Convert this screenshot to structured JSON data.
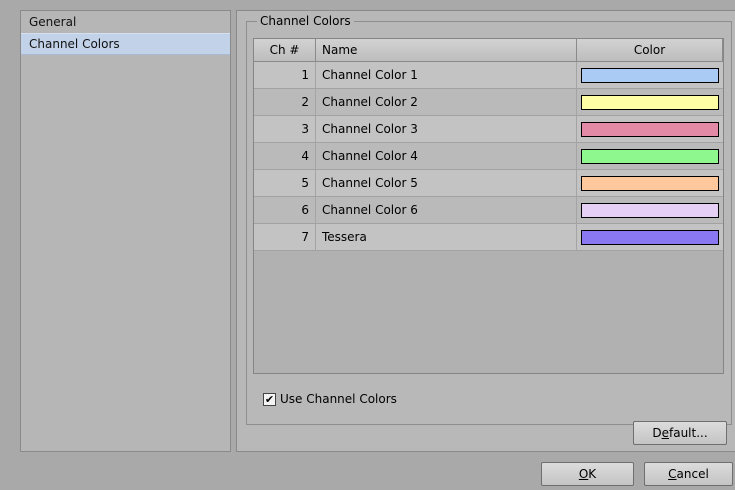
{
  "nav": {
    "items": [
      {
        "label": "General",
        "selected": false
      },
      {
        "label": "Channel Colors",
        "selected": true
      }
    ]
  },
  "group": {
    "title": "Channel Colors"
  },
  "table": {
    "columns": [
      "Ch #",
      "Name",
      "Color"
    ],
    "rows": [
      {
        "num": "1",
        "name": "Channel Color 1",
        "color": "#a9cbf4"
      },
      {
        "num": "2",
        "name": "Channel Color 2",
        "color": "#fefea4"
      },
      {
        "num": "3",
        "name": "Channel Color 3",
        "color": "#e38aa6"
      },
      {
        "num": "4",
        "name": "Channel Color 4",
        "color": "#8ef88e"
      },
      {
        "num": "5",
        "name": "Channel Color 5",
        "color": "#fec79c"
      },
      {
        "num": "6",
        "name": "Channel Color 6",
        "color": "#e6cff4"
      },
      {
        "num": "7",
        "name": "Tessera",
        "color": "#8a77f2"
      }
    ]
  },
  "use_channel_colors": {
    "label": "Use Channel Colors",
    "checked": true
  },
  "buttons": {
    "default": {
      "pre": "D",
      "ul": "e",
      "post": "fault..."
    },
    "ok": {
      "pre": "",
      "ul": "O",
      "post": "K"
    },
    "cancel": {
      "pre": "",
      "ul": "C",
      "post": "ancel"
    }
  }
}
